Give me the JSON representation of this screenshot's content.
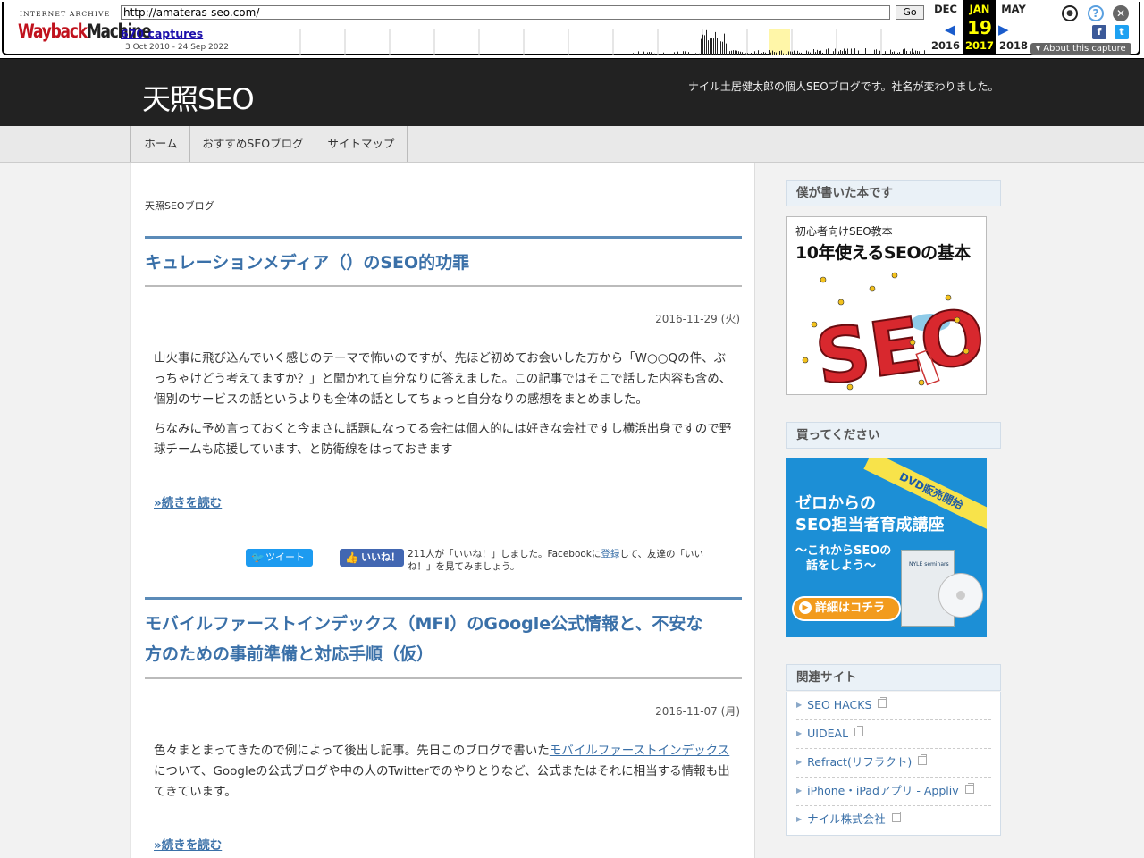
{
  "wayback": {
    "logo_top": "INTERNET ARCHIVE",
    "logo_wayback": "Wayback",
    "logo_machine": "Machine",
    "url": "http://amateras-seo.com/",
    "go_label": "Go",
    "captures_label": "670 captures",
    "date_range": "3 Oct 2010 - 24 Sep 2022",
    "prev_month": "DEC",
    "prev_year": "2016",
    "cur_month": "JAN",
    "cur_day": "19",
    "cur_year": "2017",
    "next_month": "MAY",
    "next_year": "2018",
    "about_label": "▾ About this capture"
  },
  "site": {
    "logo": "天照SEO",
    "tagline": "ナイル土居健太郎の個人SEOブログです。社名が変わりました。"
  },
  "nav": [
    "ホーム",
    "おすすめSEOブログ",
    "サイトマップ"
  ],
  "breadcrumb": "天照SEOブログ",
  "posts": [
    {
      "title": "キュレーションメディア（）のSEO的功罪",
      "date": "2016-11-29 (火)",
      "para1": "山火事に飛び込んでいく感じのテーマで怖いのですが、先ほど初めてお会いした方から「W○○Qの件、ぶっちゃけどう考えてますか？」と聞かれて自分なりに答えました。この記事ではそこで話した内容も含め、個別のサービスの話というよりも全体の話としてちょっと自分なりの感想をまとめました。",
      "para2": "ちなみに予め言っておくと今まさに話題になってる会社は個人的には好きな会社ですし横浜出身ですので野球チームも応援しています、と防衛線をはっておきます",
      "read_more": "»続きを読む",
      "tweet_label": "ツイート",
      "like_label": "いいね！",
      "fb_text_1": "211人が「いいね！」しました。Facebookに",
      "fb_link": "登録",
      "fb_text_2": "して、友達の「いいね！」を見てみましょう。"
    },
    {
      "title_line1": "モバイルファーストインデックス（MFI）のGoogle公式情報と、不安な",
      "title_line2": "方のための事前準備と対応手順（仮）",
      "date": "2016-11-07 (月)",
      "para1_a": "色々まとまってきたので例によって後出し記事。先日このブログで書いた",
      "para1_link": "モバイルファーストインデックス",
      "para1_b": "について、Googleの公式ブログや中の人のTwitterでのやりとりなど、公式またはそれに相当する情報も出てきています。",
      "read_more": "»続きを読む"
    }
  ],
  "sidebar": {
    "book_heading": "僕が書いた本です",
    "book_subtitle": "初心者向けSEO教本",
    "book_title": "10年使えるSEOの基本",
    "book_art": "SEO",
    "buy_heading": "買ってください",
    "dvd_band": "DVD販売開始",
    "dvd_line1": "ゼロからの",
    "dvd_line2": "SEO担当者育成講座",
    "dvd_line3": "〜これからSEOの",
    "dvd_line4": "話をしよう〜",
    "dvd_cta": "詳細はコチラ",
    "dvd_case_label": "NYLE seminars",
    "links_heading": "関連サイト",
    "links": [
      "SEO HACKS",
      "UIDEAL",
      "Refract(リフラクト)",
      "iPhone・iPadアプリ - Appliv",
      "ナイル株式会社"
    ]
  },
  "colors": {
    "header_bg": "#222222",
    "link_blue": "#3a70a8",
    "title_rule": "#5b8bb8",
    "sidebar_head_bg": "#eaf1f7",
    "dvd_bg": "#1c8fd6"
  }
}
